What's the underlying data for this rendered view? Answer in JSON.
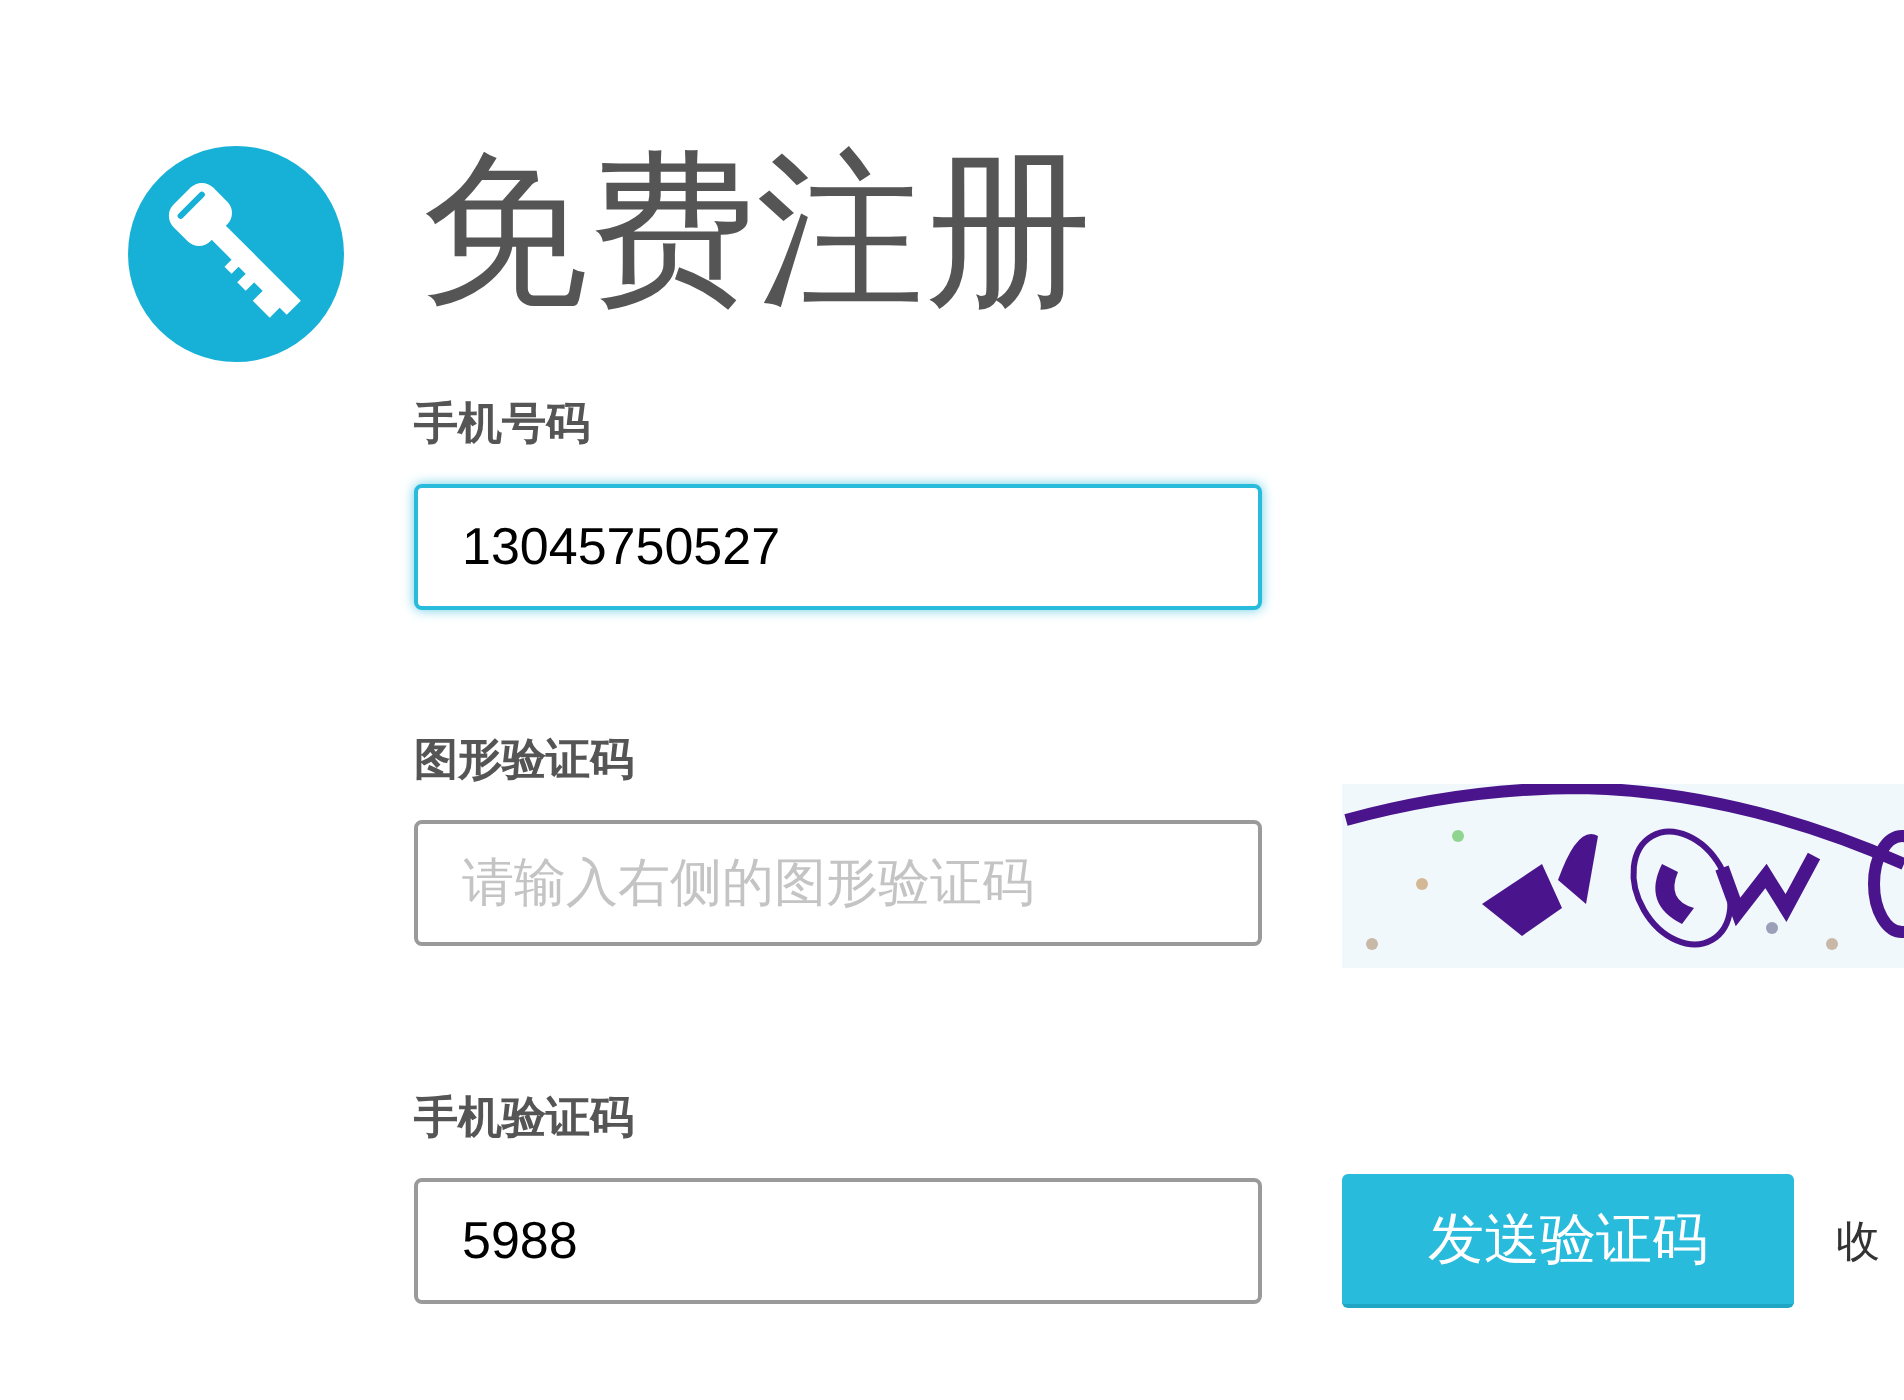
{
  "header": {
    "title": "免费注册"
  },
  "fields": [
    {
      "kind": "text",
      "label": "手机号码",
      "value": "13045750527",
      "focused": true
    },
    {
      "kind": "captcha",
      "label": "图形验证码",
      "placeholder": "请输入右侧的图形验证码",
      "focused": false
    },
    {
      "kind": "sms",
      "label": "手机验证码",
      "value": "5988",
      "focused": false,
      "button": "发送验证码",
      "note": "收"
    }
  ]
}
